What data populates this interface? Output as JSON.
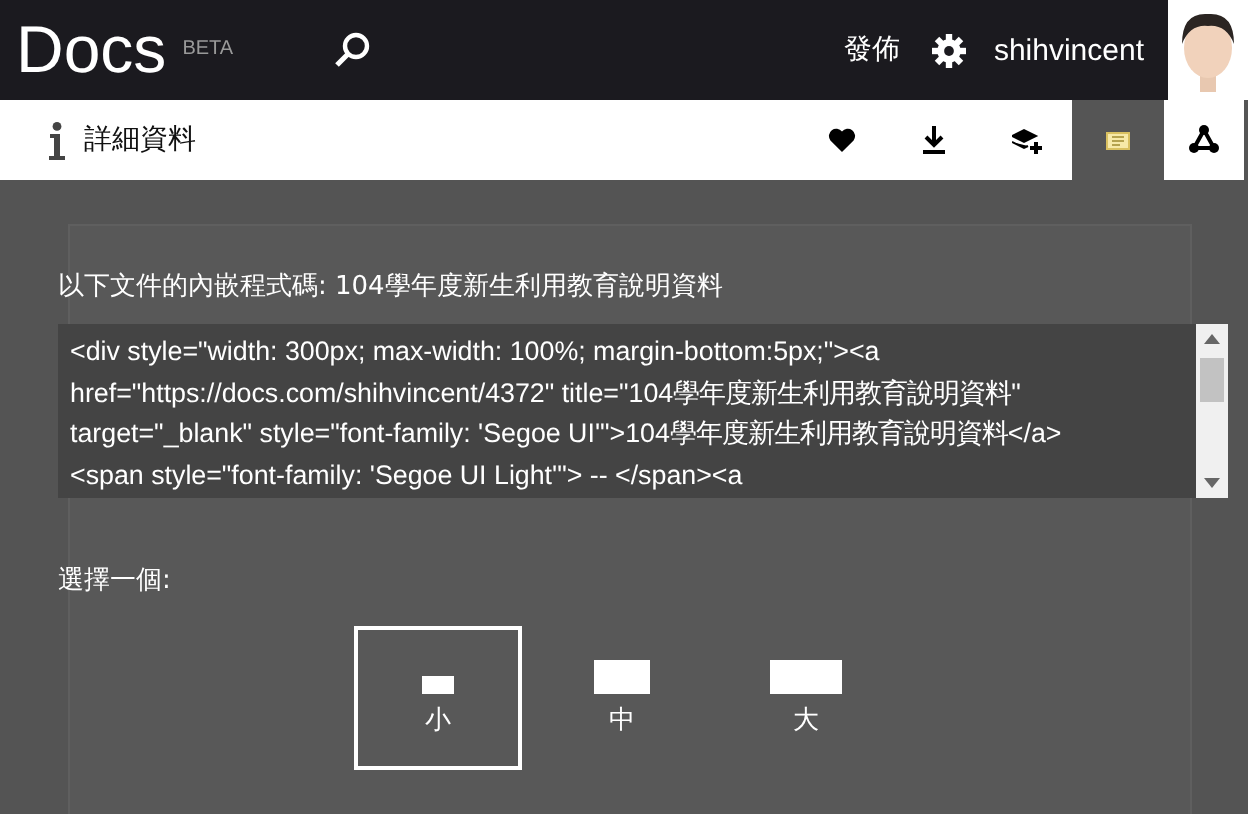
{
  "header": {
    "logo": "Docs",
    "badge": "BETA",
    "publish": "發佈",
    "user": "shihvincent"
  },
  "toolbar": {
    "title": "詳細資料",
    "actions": [
      {
        "kind": "like",
        "selected": false
      },
      {
        "kind": "download",
        "selected": false
      },
      {
        "kind": "add",
        "selected": false
      },
      {
        "kind": "embed",
        "selected": true
      },
      {
        "kind": "share",
        "selected": false
      }
    ]
  },
  "embed": {
    "label": "以下文件的內嵌程式碼: 104學年度新生利用教育說明資料",
    "code_lines": [
      "<div style=\"width: 300px; max-width: 100%; margin-bottom:5px;\"><a",
      "href=\"https://docs.com/shihvincent/4372\" title=\"104學年度新生利用教育說明資料\"",
      "target=\"_blank\" style=\"font-family: 'Segoe UI'\">104學年度新生利用教育說明資料</a>",
      "<span style=\"font-family: 'Segoe UI Light'\"> -- </span><a"
    ]
  },
  "size_picker": {
    "label": "選擇一個:",
    "options": [
      {
        "kind": "small",
        "label": "小",
        "selected": true
      },
      {
        "kind": "medium",
        "label": "中",
        "selected": false
      },
      {
        "kind": "large",
        "label": "大",
        "selected": false
      }
    ]
  }
}
